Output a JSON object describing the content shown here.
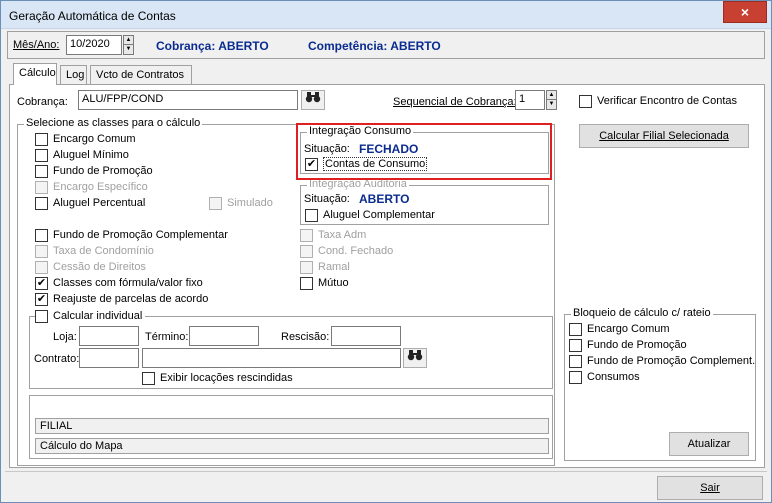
{
  "window": {
    "title": "Geração Automática de Contas",
    "close_icon": "×"
  },
  "topbar": {
    "mes_ano_label": "Mês/Ano:",
    "mes_ano_value": "10/2020",
    "cobranca_status": "Cobrança: ABERTO",
    "competencia_status": "Competência: ABERTO"
  },
  "tabs": [
    {
      "label": "Cálculo",
      "active": true
    },
    {
      "label": "Log",
      "active": false
    },
    {
      "label": "Vcto de Contratos",
      "active": false
    }
  ],
  "calculo": {
    "cobranca_label": "Cobrança:",
    "cobranca_value": "ALU/FPP/COND",
    "sequencial_label": "Sequencial de Cobrança:",
    "sequencial_value": "1",
    "verificar_label": "Verificar Encontro de Contas",
    "calcular_filial_button": "Calcular Filial Selecionada",
    "classes_group_title": "Selecione as classes para o cálculo",
    "classes": [
      {
        "label": "Encargo Comum",
        "checked": false,
        "enabled": true
      },
      {
        "label": "Aluguel Mínimo",
        "checked": false,
        "enabled": true
      },
      {
        "label": "Fundo de Promoção",
        "checked": false,
        "enabled": true
      },
      {
        "label": "Encargo Específico",
        "checked": false,
        "enabled": false
      },
      {
        "label": "Aluguel Percentual",
        "checked": false,
        "enabled": true
      },
      {
        "label": "Fundo de Promoção Complementar",
        "checked": false,
        "enabled": true
      },
      {
        "label": "Taxa de Condomínio",
        "checked": false,
        "enabled": false
      },
      {
        "label": "Cessão de Direitos",
        "checked": false,
        "enabled": false
      },
      {
        "label": "Classes com fórmula/valor fixo",
        "checked": true,
        "enabled": true
      },
      {
        "label": "Reajuste de parcelas de acordo",
        "checked": true,
        "enabled": true
      }
    ],
    "simulado_label": "Simulado",
    "classes_right": [
      {
        "label": "Taxa Adm",
        "checked": false,
        "enabled": false
      },
      {
        "label": "Cond. Fechado",
        "checked": false,
        "enabled": false
      },
      {
        "label": "Ramal",
        "checked": false,
        "enabled": false
      },
      {
        "label": "Mútuo",
        "checked": false,
        "enabled": true
      }
    ],
    "integracao_consumo": {
      "title": "Integração Consumo",
      "situacao_label": "Situação:",
      "situacao_value": "FECHADO",
      "contas_consumo_label": "Contas de Consumo",
      "contas_consumo_checked": true
    },
    "integracao_auditoria": {
      "title": "Integração Auditoria",
      "situacao_label": "Situação:",
      "situacao_value": "ABERTO",
      "aluguel_complementar_label": "Aluguel Complementar",
      "aluguel_complementar_checked": false
    },
    "calcular_individual": {
      "title": "Calcular individual",
      "loja_label": "Loja:",
      "termino_label": "Término:",
      "rescisao_label": "Rescisão:",
      "contrato_label": "Contrato:",
      "exibir_locacoes_label": "Exibir locações rescindidas"
    },
    "status_lines": [
      "FILIAL",
      "Cálculo do Mapa"
    ],
    "bloqueio": {
      "title": "Bloqueio de cálculo c/ rateio",
      "items": [
        "Encargo Comum",
        "Fundo de Promoção",
        "Fundo de Promoção Complement.",
        "Consumos"
      ],
      "atualizar_button": "Atualizar"
    }
  },
  "footer": {
    "sair_button": "Sair"
  },
  "colors": {
    "status_blue": "#0a2b8f",
    "highlight_red": "#e02020"
  }
}
